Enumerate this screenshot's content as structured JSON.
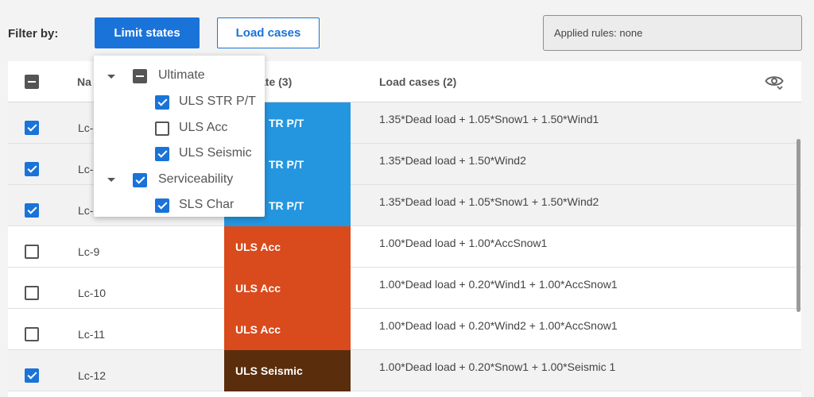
{
  "filter": {
    "label": "Filter by:",
    "limit_states_label": "Limit states",
    "load_cases_label": "Load cases",
    "applied_rules": "Applied rules: none"
  },
  "table": {
    "headers": {
      "name": "Na",
      "limit_state": "ate (3)",
      "load_cases": "Load cases (2)"
    },
    "rows": [
      {
        "name": "Lc-",
        "limit_state": "TR P/T",
        "load_case": "1.35*Dead load + 1.05*Snow1 + 1.50*Wind1",
        "checked": true,
        "color": "#2496e0"
      },
      {
        "name": "Lc-",
        "limit_state": "TR P/T",
        "load_case": "1.35*Dead load + 1.50*Wind2",
        "checked": true,
        "color": "#2496e0"
      },
      {
        "name": "Lc-",
        "limit_state": "TR P/T",
        "load_case": "1.35*Dead load + 1.05*Snow1 + 1.50*Wind2",
        "checked": true,
        "color": "#2496e0"
      },
      {
        "name": "Lc-9",
        "limit_state": "ULS Acc",
        "load_case": "1.00*Dead load + 1.00*AccSnow1",
        "checked": false,
        "color": "#d94a1c"
      },
      {
        "name": "Lc-10",
        "limit_state": "ULS Acc",
        "load_case": "1.00*Dead load + 0.20*Wind1 + 1.00*AccSnow1",
        "checked": false,
        "color": "#d94a1c"
      },
      {
        "name": "Lc-11",
        "limit_state": "ULS Acc",
        "load_case": "1.00*Dead load + 0.20*Wind2 + 1.00*AccSnow1",
        "checked": false,
        "color": "#d94a1c"
      },
      {
        "name": "Lc-12",
        "limit_state": "ULS Seismic",
        "load_case": "1.00*Dead load + 0.20*Snow1 + 1.00*Seismic 1",
        "checked": true,
        "color": "#5a2d0c"
      }
    ]
  },
  "popup": {
    "ultimate": "Ultimate",
    "uls_str": "ULS STR P/T",
    "uls_acc": "ULS Acc",
    "uls_seismic": "ULS Seismic",
    "serviceability": "Serviceability",
    "sls_char": "SLS Char"
  },
  "colors": {
    "accent": "#1a73d9",
    "uls_str": "#2496e0",
    "uls_acc": "#d94a1c",
    "uls_seismic": "#5a2d0c"
  },
  "icons": {
    "visibility": "eye-settings-icon"
  }
}
